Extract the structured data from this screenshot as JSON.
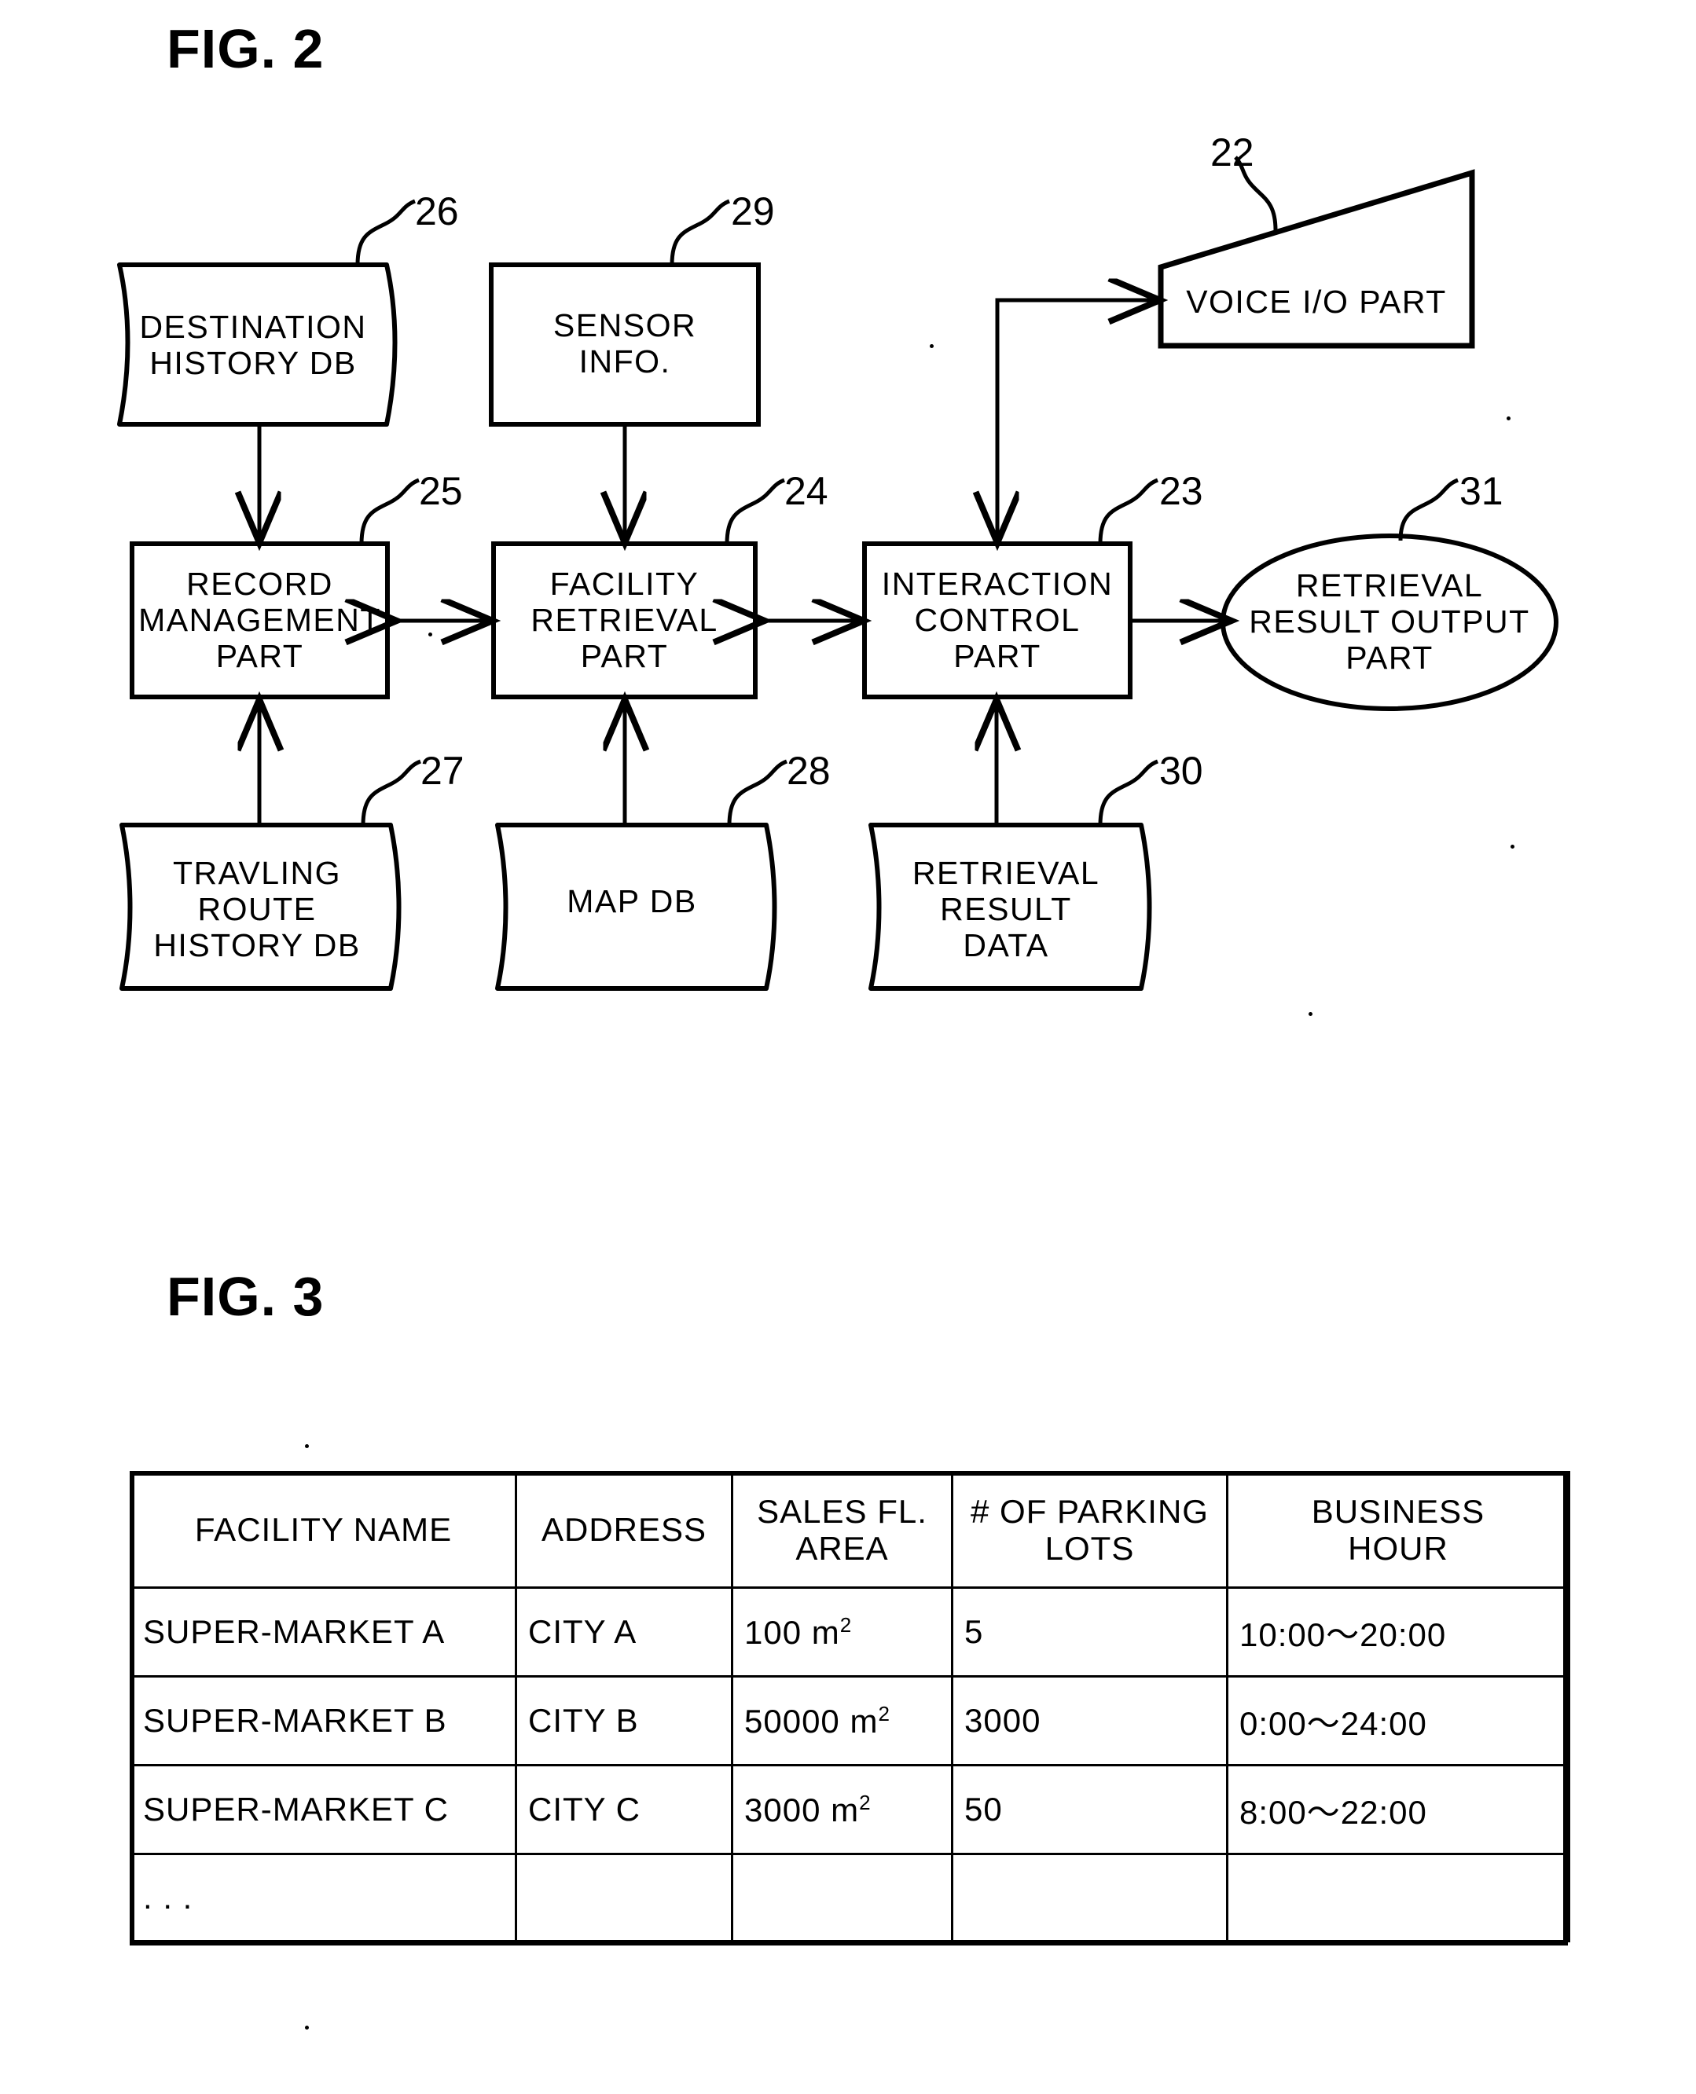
{
  "figures": {
    "fig2": {
      "title": "FIG. 2",
      "nodes": [
        {
          "id": "destination-history-db",
          "label": "DESTINATION\nHISTORY DB",
          "ref": "26",
          "shape": "data-store"
        },
        {
          "id": "sensor-info",
          "label": "SENSOR\nINFO.",
          "ref": "29",
          "shape": "rect"
        },
        {
          "id": "voice-io-part",
          "label": "VOICE I/O PART",
          "ref": "22",
          "shape": "trapezoid"
        },
        {
          "id": "record-management-part",
          "label": "RECORD\nMANAGEMENT\nPART",
          "ref": "25",
          "shape": "rect"
        },
        {
          "id": "facility-retrieval-part",
          "label": "FACILITY\nRETRIEVAL\nPART",
          "ref": "24",
          "shape": "rect"
        },
        {
          "id": "interaction-control-part",
          "label": "INTERACTION\nCONTROL\nPART",
          "ref": "23",
          "shape": "rect"
        },
        {
          "id": "retrieval-result-output-part",
          "label": "RETRIEVAL\nRESULT OUTPUT\nPART",
          "ref": "31",
          "shape": "ellipse"
        },
        {
          "id": "travling-route-history-db",
          "label": "TRAVLING\nROUTE\nHISTORY DB",
          "ref": "27",
          "shape": "data-store"
        },
        {
          "id": "map-db",
          "label": "MAP DB",
          "ref": "28",
          "shape": "data-store"
        },
        {
          "id": "retrieval-result-data",
          "label": "RETRIEVAL\nRESULT\nDATA",
          "ref": "30",
          "shape": "data-store"
        }
      ],
      "labels": {
        "destination_history_db_l1": "DESTINATION",
        "destination_history_db_l2": "HISTORY DB",
        "sensor_info_l1": "SENSOR",
        "sensor_info_l2": "INFO.",
        "voice_io_part": "VOICE I/O PART",
        "record_management_part_l1": "RECORD",
        "record_management_part_l2": "MANAGEMENT",
        "record_management_part_l3": "PART",
        "facility_retrieval_part_l1": "FACILITY",
        "facility_retrieval_part_l2": "RETRIEVAL",
        "facility_retrieval_part_l3": "PART",
        "interaction_control_part_l1": "INTERACTION",
        "interaction_control_part_l2": "CONTROL",
        "interaction_control_part_l3": "PART",
        "retrieval_result_output_part_l1": "RETRIEVAL",
        "retrieval_result_output_part_l2": "RESULT OUTPUT",
        "retrieval_result_output_part_l3": "PART",
        "travling_route_history_db_l1": "TRAVLING",
        "travling_route_history_db_l2": "ROUTE",
        "travling_route_history_db_l3": "HISTORY DB",
        "map_db": "MAP DB",
        "retrieval_result_data_l1": "RETRIEVAL",
        "retrieval_result_data_l2": "RESULT",
        "retrieval_result_data_l3": "DATA"
      },
      "refs": {
        "r22": "22",
        "r23": "23",
        "r24": "24",
        "r25": "25",
        "r26": "26",
        "r27": "27",
        "r28": "28",
        "r29": "29",
        "r30": "30",
        "r31": "31"
      }
    },
    "fig3": {
      "title": "FIG. 3",
      "table": {
        "columns": [
          "FACILITY NAME",
          "ADDRESS",
          "SALES FL.\nAREA",
          "# OF PARKING\nLOTS",
          "BUSINESS\nHOUR"
        ],
        "headers": {
          "facility_name": "FACILITY NAME",
          "address": "ADDRESS",
          "sales_fl_area_l1": "SALES FL.",
          "sales_fl_area_l2": "AREA",
          "parking_lots_l1": "# OF PARKING",
          "parking_lots_l2": "LOTS",
          "business_hour_l1": "BUSINESS",
          "business_hour_l2": "HOUR"
        },
        "rows": [
          {
            "facility_name": "SUPER-MARKET A",
            "address": "CITY A",
            "sales_area_value": "100",
            "sales_area_unit": "m",
            "sales_area_exp": "2",
            "parking_lots": "5",
            "business_hour": "10:00〜20:00"
          },
          {
            "facility_name": "SUPER-MARKET B",
            "address": "CITY B",
            "sales_area_value": "50000",
            "sales_area_unit": "m",
            "sales_area_exp": "2",
            "parking_lots": "3000",
            "business_hour": "0:00〜24:00"
          },
          {
            "facility_name": "SUPER-MARKET C",
            "address": "CITY C",
            "sales_area_value": "3000",
            "sales_area_unit": "m",
            "sales_area_exp": "2",
            "parking_lots": "50",
            "business_hour": "8:00〜22:00"
          },
          {
            "facility_name": ". . .",
            "address": "",
            "sales_area_value": "",
            "sales_area_unit": "",
            "sales_area_exp": "",
            "parking_lots": "",
            "business_hour": ""
          }
        ]
      }
    }
  },
  "colors": {
    "ink": "#000000",
    "paper": "#ffffff"
  }
}
